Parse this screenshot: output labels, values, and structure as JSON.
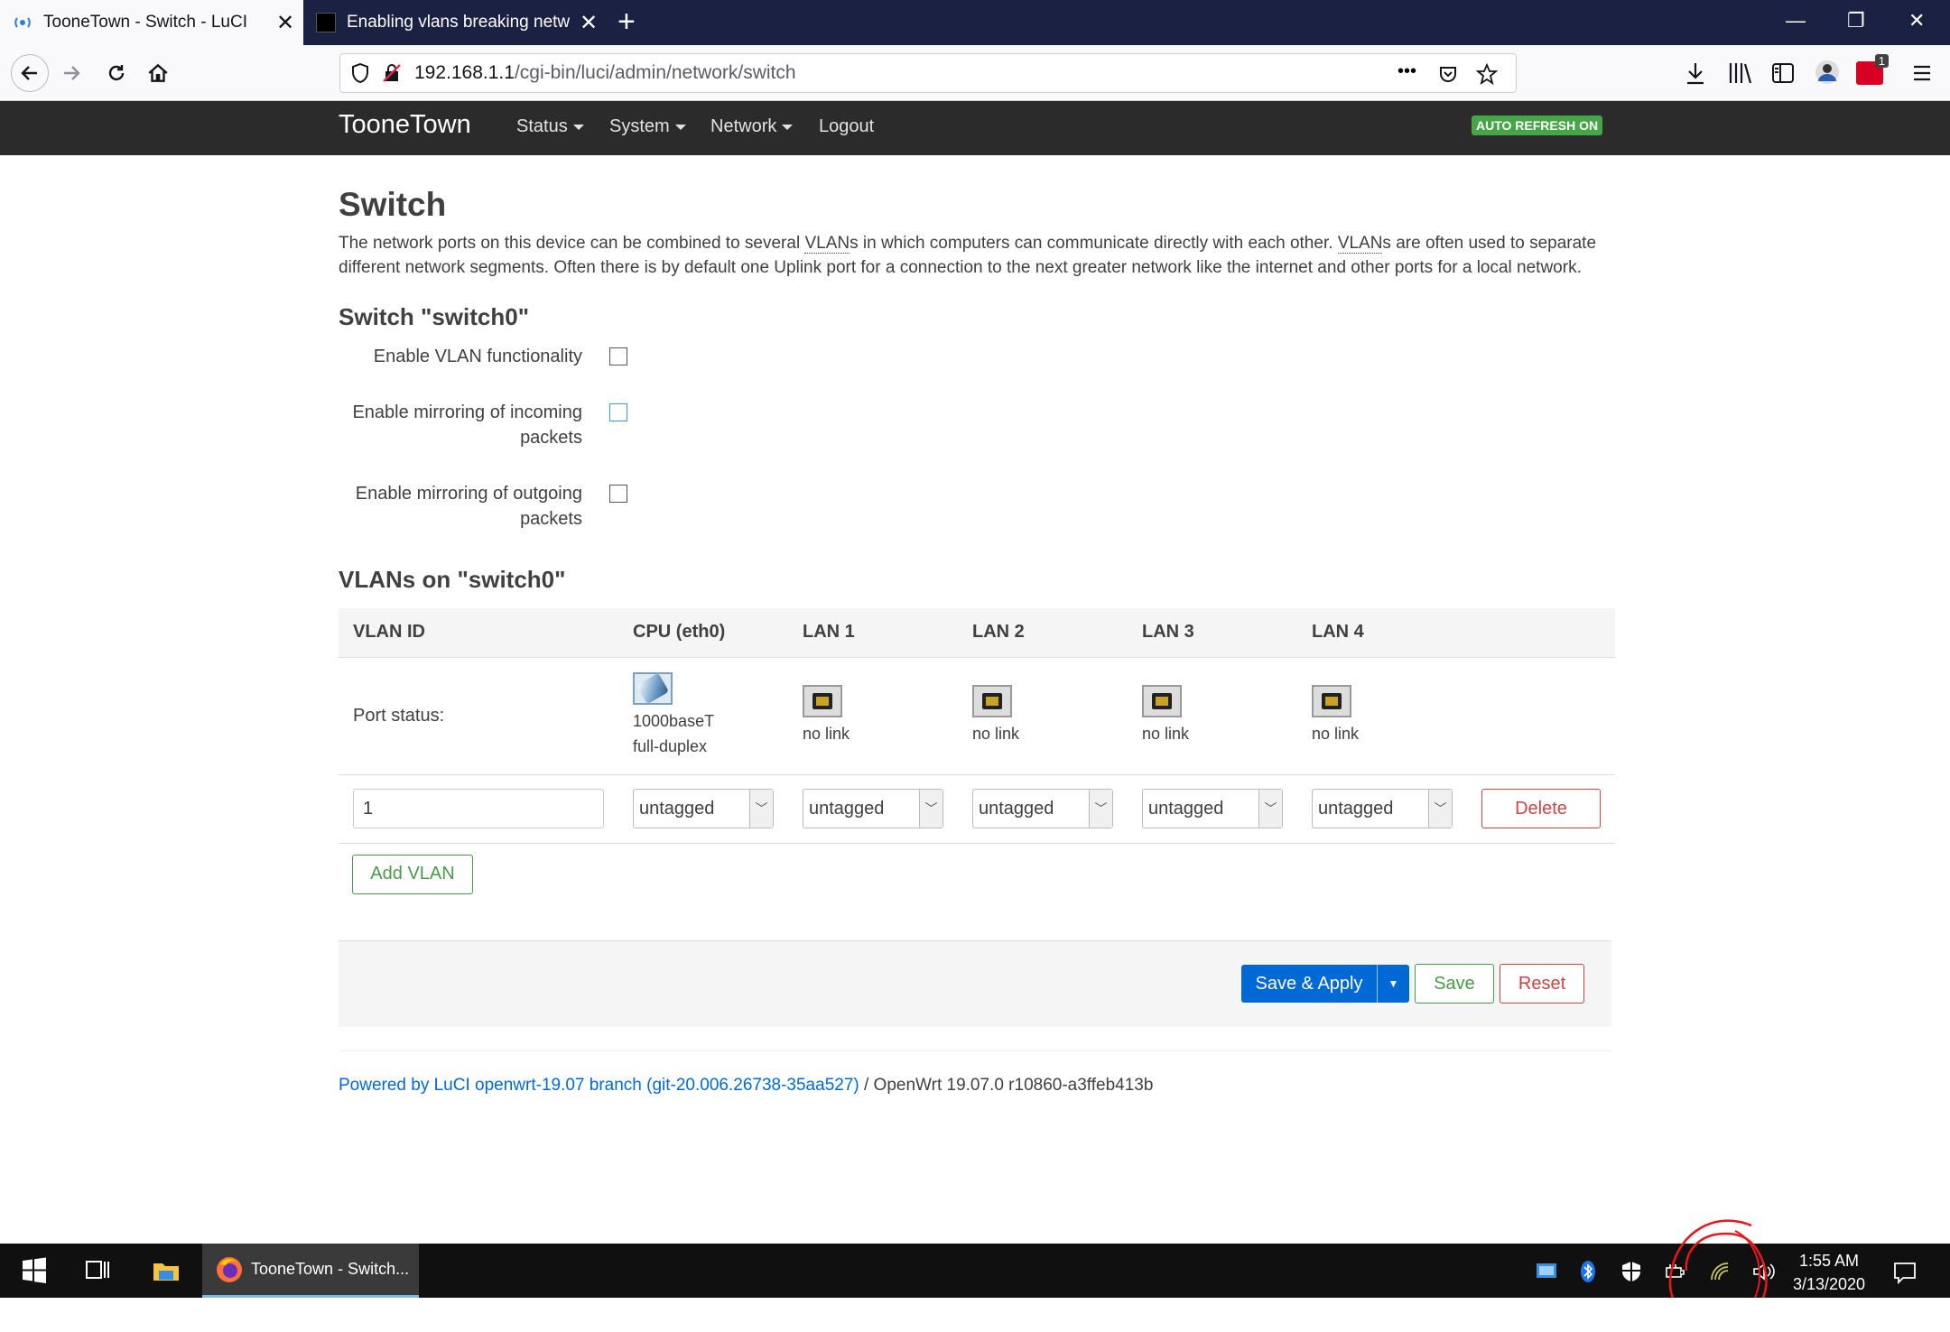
{
  "browser": {
    "tabs": [
      {
        "title": "TooneTown - Switch - LuCI",
        "active": true
      },
      {
        "title": "Enabling vlans breaking networ",
        "active": false
      }
    ],
    "url_host": "192.168.1.1",
    "url_path": "/cgi-bin/luci/admin/network/switch",
    "more_label": "•••",
    "notification_count": "1"
  },
  "luci": {
    "brand": "TooneTown",
    "menu": [
      "Status",
      "System",
      "Network",
      "Logout"
    ],
    "auto_refresh": "AUTO REFRESH ON"
  },
  "page": {
    "title": "Switch",
    "desc_1": "The network ports on this device can be combined to several ",
    "vlans_word": "VLAN",
    "desc_2": "s in which computers can communicate directly with each other. ",
    "desc_3": "s are often used to separate different network segments. Often there is by default one Uplink port for a connection to the next greater network like the internet and other ports for a local network.",
    "switch_heading": "Switch \"switch0\"",
    "options": [
      {
        "label": "Enable VLAN functionality",
        "checked": false
      },
      {
        "label": "Enable mirroring of incoming packets",
        "checked": false
      },
      {
        "label": "Enable mirroring of outgoing packets",
        "checked": false
      }
    ],
    "vlans_heading": "VLANs on \"switch0\""
  },
  "vlan_table": {
    "headers": [
      "VLAN ID",
      "CPU (eth0)",
      "LAN 1",
      "LAN 2",
      "LAN 3",
      "LAN 4"
    ],
    "port_status_label": "Port status:",
    "port_status": [
      {
        "line1": "1000baseT",
        "line2": "full-duplex",
        "link": true
      },
      {
        "line1": "no link",
        "line2": "",
        "link": false
      },
      {
        "line1": "no link",
        "line2": "",
        "link": false
      },
      {
        "line1": "no link",
        "line2": "",
        "link": false
      },
      {
        "line1": "no link",
        "line2": "",
        "link": false
      }
    ],
    "rows": [
      {
        "vlan_id": "1",
        "ports": [
          "untagged",
          "untagged",
          "untagged",
          "untagged",
          "untagged"
        ],
        "delete_label": "Delete"
      }
    ],
    "add_label": "Add VLAN"
  },
  "actions": {
    "save_apply": "Save & Apply",
    "save": "Save",
    "reset": "Reset"
  },
  "footer": {
    "link_text": "Powered by LuCI openwrt-19.07 branch (git-20.006.26738-35aa527)",
    "rest": " / OpenWrt 19.07.0 r10860-a3ffeb413b"
  },
  "taskbar": {
    "app_title": "TooneTown - Switch...",
    "time": "1:55 AM",
    "date": "3/13/2020"
  },
  "colors": {
    "tabstrip": "#1b2142",
    "luci_header": "#2b2b2b",
    "primary": "#0069d6",
    "success": "#46a546",
    "danger": "#cc4444"
  }
}
